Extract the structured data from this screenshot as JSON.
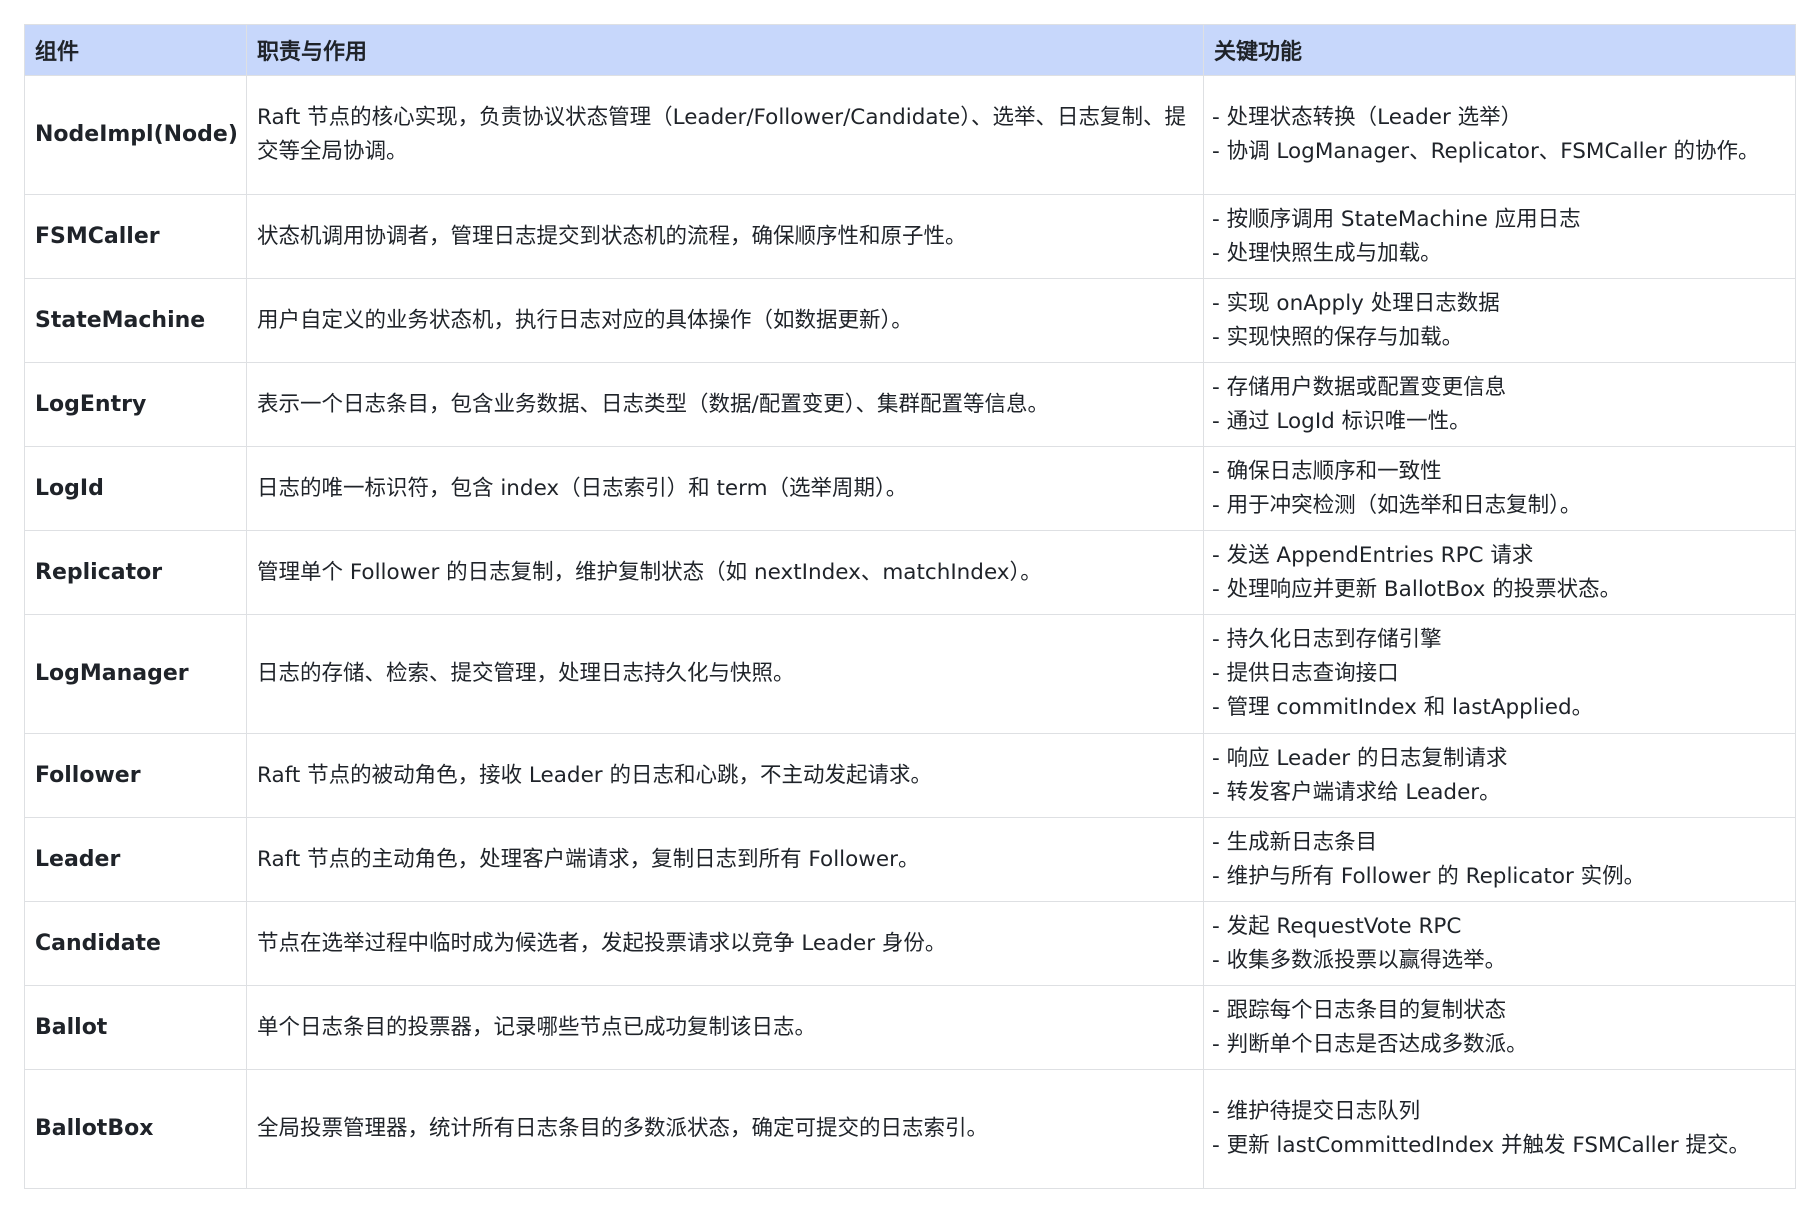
{
  "table": {
    "headers": [
      "组件",
      "职责与作用",
      "关键功能"
    ],
    "rows": [
      {
        "component": "NodeImpl(Node)",
        "responsibility": "Raft 节点的核心实现，负责协议状态管理（Leader/Follower/Candidate）、选举、日志复制、提交等全局协调。",
        "functions": [
          "- 处理状态转换（Leader 选举）",
          "- 协调 LogManager、Replicator、FSMCaller 的协作。"
        ]
      },
      {
        "component": "FSMCaller",
        "responsibility": "状态机调用协调者，管理日志提交到状态机的流程，确保顺序性和原子性。",
        "functions": [
          "- 按顺序调用 StateMachine 应用日志",
          "- 处理快照生成与加载。"
        ]
      },
      {
        "component": "StateMachine",
        "responsibility": "用户自定义的业务状态机，执行日志对应的具体操作（如数据更新）。",
        "functions": [
          "- 实现 onApply 处理日志数据",
          "- 实现快照的保存与加载。"
        ]
      },
      {
        "component": "LogEntry",
        "responsibility": "表示一个日志条目，包含业务数据、日志类型（数据/配置变更）、集群配置等信息。",
        "functions": [
          "- 存储用户数据或配置变更信息",
          "- 通过 LogId 标识唯一性。"
        ]
      },
      {
        "component": "LogId",
        "responsibility": "日志的唯一标识符，包含 index（日志索引）和 term（选举周期）。",
        "functions": [
          "- 确保日志顺序和一致性",
          "- 用于冲突检测（如选举和日志复制）。"
        ]
      },
      {
        "component": "Replicator",
        "responsibility": "管理单个 Follower 的日志复制，维护复制状态（如 nextIndex、matchIndex）。",
        "functions": [
          "- 发送 AppendEntries RPC 请求",
          "- 处理响应并更新 BallotBox 的投票状态。"
        ]
      },
      {
        "component": "LogManager",
        "responsibility": "日志的存储、检索、提交管理，处理日志持久化与快照。",
        "functions": [
          "- 持久化日志到存储引擎",
          "- 提供日志查询接口",
          "- 管理 commitIndex 和 lastApplied。"
        ]
      },
      {
        "component": "Follower",
        "responsibility": "Raft 节点的被动角色，接收 Leader 的日志和心跳，不主动发起请求。",
        "functions": [
          "- 响应 Leader 的日志复制请求",
          "- 转发客户端请求给 Leader。"
        ]
      },
      {
        "component": "Leader",
        "responsibility": "Raft 节点的主动角色，处理客户端请求，复制日志到所有 Follower。",
        "functions": [
          "- 生成新日志条目",
          "- 维护与所有 Follower 的 Replicator 实例。"
        ]
      },
      {
        "component": "Candidate",
        "responsibility": "节点在选举过程中临时成为候选者，发起投票请求以竞争 Leader 身份。",
        "functions": [
          "- 发起 RequestVote RPC",
          "- 收集多数派投票以赢得选举。"
        ]
      },
      {
        "component": "Ballot",
        "responsibility": "单个日志条目的投票器，记录哪些节点已成功复制该日志。",
        "functions": [
          "- 跟踪每个日志条目的复制状态",
          "- 判断单个日志是否达成多数派。"
        ]
      },
      {
        "component": "BallotBox",
        "responsibility": "全局投票管理器，统计所有日志条目的多数派状态，确定可提交的日志索引。",
        "functions": [
          "- 维护待提交日志队列",
          "- 更新 lastCommittedIndex 并触发 FSMCaller 提交。"
        ]
      }
    ]
  },
  "colors": {
    "header_bg": "#c7d7fb",
    "border": "#dee0e3",
    "text": "#1f2329"
  }
}
